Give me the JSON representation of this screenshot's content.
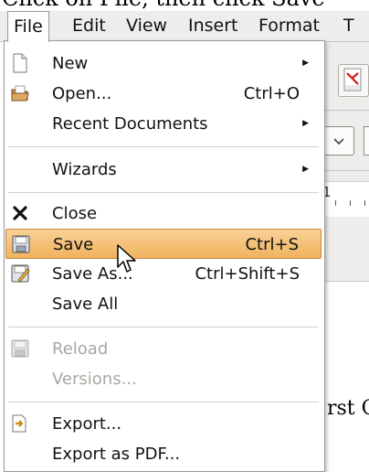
{
  "caption": "Click on File, then click Save",
  "menubar": {
    "items": [
      "File",
      "Edit",
      "View",
      "Insert",
      "Format",
      "T"
    ]
  },
  "menu": {
    "items": [
      {
        "label": "New",
        "shortcut": "",
        "submenu": true,
        "icon": "new-document-icon",
        "disabled": false
      },
      {
        "label": "Open...",
        "shortcut": "Ctrl+O",
        "submenu": false,
        "icon": "open-folder-icon",
        "disabled": false
      },
      {
        "label": "Recent Documents",
        "shortcut": "",
        "submenu": true,
        "icon": "",
        "disabled": false
      },
      {
        "label": "Wizards",
        "shortcut": "",
        "submenu": true,
        "icon": "",
        "disabled": false
      },
      {
        "label": "Close",
        "shortcut": "",
        "submenu": false,
        "icon": "close-x-icon",
        "disabled": false
      },
      {
        "label": "Save",
        "shortcut": "Ctrl+S",
        "submenu": false,
        "icon": "save-disk-icon",
        "disabled": false,
        "highlighted": true
      },
      {
        "label": "Save As...",
        "shortcut": "Ctrl+Shift+S",
        "submenu": false,
        "icon": "save-as-icon",
        "disabled": false
      },
      {
        "label": "Save All",
        "shortcut": "",
        "submenu": false,
        "icon": "",
        "disabled": false
      },
      {
        "label": "Reload",
        "shortcut": "",
        "submenu": false,
        "icon": "reload-icon",
        "disabled": true
      },
      {
        "label": "Versions...",
        "shortcut": "",
        "submenu": false,
        "icon": "",
        "disabled": true
      },
      {
        "label": "Export...",
        "shortcut": "",
        "submenu": false,
        "icon": "export-icon",
        "disabled": false
      },
      {
        "label": "Export as PDF...",
        "shortcut": "",
        "submenu": false,
        "icon": "",
        "disabled": false
      }
    ]
  },
  "ruler": {
    "number": "1"
  },
  "document": {
    "text_fragment": "rst C"
  },
  "colors": {
    "highlight": "#f0b35f",
    "menubar_bg": "#eeedeb",
    "disabled_text": "#a9a7a2"
  }
}
